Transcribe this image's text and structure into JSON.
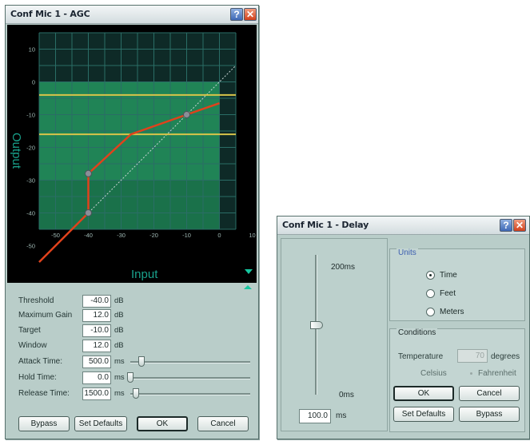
{
  "agc": {
    "title": "Conf Mic 1 - AGC",
    "help_glyph": "?",
    "close_glyph": "✕",
    "graph": {
      "y_ticks": [
        "10",
        "0",
        "-10",
        "-20",
        "-30",
        "-40",
        "-50"
      ],
      "x_ticks": [
        "-50",
        "-40",
        "-30",
        "-20",
        "-10",
        "0",
        "10"
      ],
      "y_label": "Output",
      "x_label": "Input",
      "colors": {
        "background": "#000000",
        "grid": "#2a6d66",
        "active": "#1f8a57",
        "curve": "#e0421c",
        "limit": "#d8c44a"
      },
      "limit_lines_db": [
        -4,
        -16
      ],
      "curve_points_db": [
        [
          -55,
          -55
        ],
        [
          -40,
          -40
        ],
        [
          -40,
          -28
        ],
        [
          -27,
          -16
        ],
        [
          -10,
          -10
        ],
        [
          0,
          -6.5
        ]
      ]
    },
    "params": [
      {
        "label": "Threshold",
        "value": "-40.0",
        "unit": "dB"
      },
      {
        "label": "Maximum Gain",
        "value": "12.0",
        "unit": "dB"
      },
      {
        "label": "Target",
        "value": "-10.0",
        "unit": "dB"
      },
      {
        "label": "Window",
        "value": "12.0",
        "unit": "dB"
      },
      {
        "label": "Attack Time:",
        "value": "500.0",
        "unit": "ms"
      },
      {
        "label": "Hold Time:",
        "value": "0.0",
        "unit": "ms"
      },
      {
        "label": "Release Time:",
        "value": "1500.0",
        "unit": "ms"
      }
    ],
    "sliders": {
      "attack_level": 0.07,
      "hold_level": 0.0,
      "release_level": 0.02
    },
    "buttons": {
      "bypass": "Bypass",
      "set_defaults": "Set Defaults",
      "ok": "OK",
      "cancel": "Cancel"
    }
  },
  "delay": {
    "title": "Conf Mic 1 - Delay",
    "help_glyph": "?",
    "close_glyph": "✕",
    "slider": {
      "max_label": "200ms",
      "min_label": "0ms",
      "value": "100.0",
      "unit": "ms",
      "level": 0.5
    },
    "units": {
      "title": "Units",
      "options": [
        {
          "label": "Time",
          "selected": true
        },
        {
          "label": "Feet",
          "selected": false
        },
        {
          "label": "Meters",
          "selected": false
        }
      ]
    },
    "conditions": {
      "title": "Conditions",
      "temperature_label": "Temperature",
      "temperature_value": "70",
      "temperature_unit": "degrees",
      "celsius": "Celsius",
      "fahrenheit": "Fahrenheit"
    },
    "buttons": {
      "ok": "OK",
      "cancel": "Cancel",
      "set_defaults": "Set Defaults",
      "bypass": "Bypass"
    }
  }
}
